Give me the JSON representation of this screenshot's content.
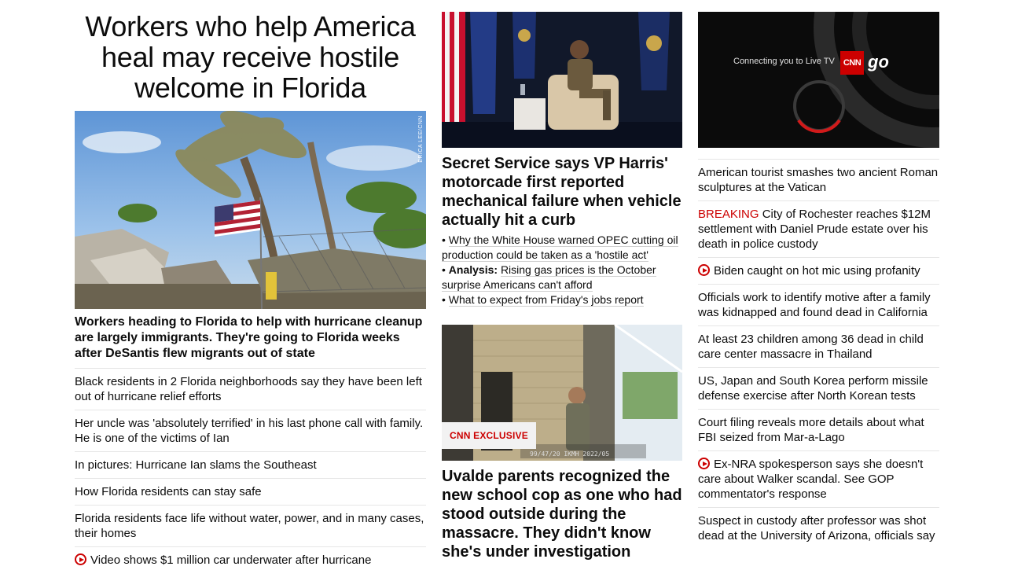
{
  "col1": {
    "headline": "Workers who help America heal may receive hostile welcome in Florida",
    "photo_credit": "ERICA LEE/CNN",
    "lead": "Workers heading to Florida to help with hurricane cleanup are largely immigrants. They're going to Florida weeks after DeSantis flew migrants out of state",
    "items": [
      {
        "text": "Black residents in 2 Florida neighborhoods say they have been left out of hurricane relief efforts",
        "video": false
      },
      {
        "text": "Her uncle was 'absolutely terrified' in his last phone call with family. He is one of the victims of Ian",
        "video": false
      },
      {
        "text": "In pictures: Hurricane Ian slams the Southeast",
        "video": false
      },
      {
        "text": "How Florida residents can stay safe",
        "video": false
      },
      {
        "text": "Florida residents face life without water, power, and in many cases, their homes",
        "video": false
      },
      {
        "text": "Video shows $1 million car underwater after hurricane",
        "video": true
      }
    ]
  },
  "col2": {
    "headline1": "Secret Service says VP Harris' motorcade first reported mechanical failure when vehicle actually hit a curb",
    "bullet1": "Why the White House warned OPEC cutting oil production could be taken as a 'hostile act'",
    "bullet2_prefix": "Analysis:",
    "bullet2": "Rising gas prices is the October surprise Americans can't afford",
    "bullet3": "What to expect from Friday's jobs report",
    "badge": "CNN EXCLUSIVE",
    "cam_stamp": "99/47/20 IKMH 2022/05",
    "headline2": "Uvalde parents recognized the new school cop as one who had stood outside during the massacre. They didn't know she's under investigation"
  },
  "col3": {
    "live_text": "Connecting you to Live TV",
    "logo_text": "CNN",
    "go_text": "go",
    "breaking_label": "BREAKING",
    "items": [
      {
        "text": "American tourist smashes two ancient Roman sculptures at the Vatican",
        "video": false,
        "breaking": false
      },
      {
        "text": "City of Rochester reaches $12M settlement with Daniel Prude estate over his death in police custody",
        "video": false,
        "breaking": true
      },
      {
        "text": "Biden caught on hot mic using profanity",
        "video": true,
        "breaking": false
      },
      {
        "text": "Officials work to identify motive after a family was kidnapped and found dead in California",
        "video": false,
        "breaking": false
      },
      {
        "text": "At least 23 children among 36 dead in child care center massacre in Thailand",
        "video": false,
        "breaking": false
      },
      {
        "text": "US, Japan and South Korea perform missile defense exercise after North Korean tests",
        "video": false,
        "breaking": false
      },
      {
        "text": "Court filing reveals more details about what FBI seized from Mar-a-Lago",
        "video": false,
        "breaking": false
      },
      {
        "text": "Ex-NRA spokesperson says she doesn't care about Walker scandal. See GOP commentator's response",
        "video": true,
        "breaking": false
      },
      {
        "text": "Suspect in custody after professor was shot dead at the University of Arizona, officials say",
        "video": false,
        "breaking": false
      }
    ]
  }
}
